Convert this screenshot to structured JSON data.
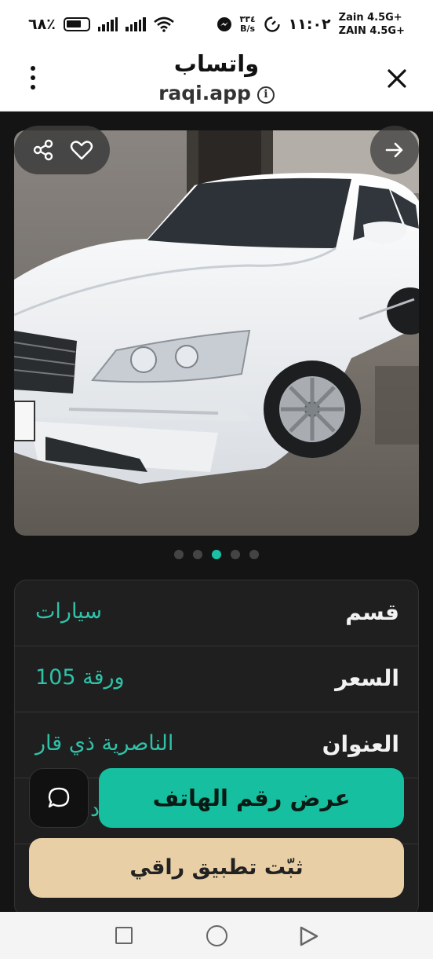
{
  "status_bar": {
    "battery": "٦٨٪",
    "carrier_line1": "Zain 4.5G+",
    "carrier_line2": "ZAIN 4.5G+",
    "time": "١١:٠٢",
    "speed_value": "٣٣٤",
    "speed_unit": "B/s"
  },
  "header": {
    "title": "واتساب",
    "url": "raqi.app"
  },
  "gallery": {
    "total_images": 5,
    "active_index": 2
  },
  "details": {
    "rows": [
      {
        "label": "قسم",
        "value": "سيارات"
      },
      {
        "label": "السعر",
        "value": "105 ورقة"
      },
      {
        "label": "العنوان",
        "value": "الناصرية ذي قار"
      },
      {
        "label": "",
        "value": "د"
      }
    ]
  },
  "actions": {
    "phone_label": "عرض رقم الهاتف",
    "install_label": "ثبّت تطبيق راقي"
  },
  "colors": {
    "accent": "#16bf9f",
    "install_bg": "#e8cfa5",
    "background": "#141414"
  }
}
